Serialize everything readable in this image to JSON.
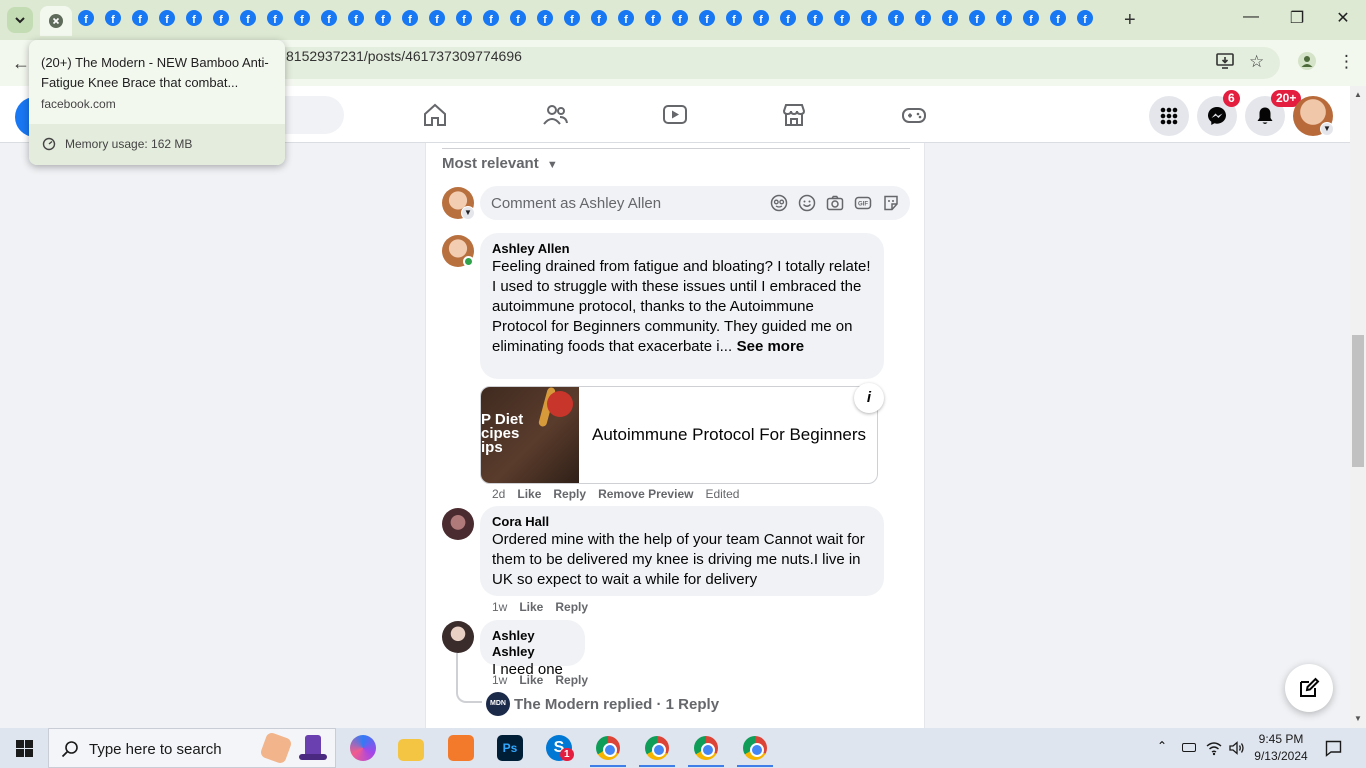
{
  "browser": {
    "url_visible": "8152937231/posts/461737309774696",
    "favicon_letter": "f",
    "favicon_count": 38,
    "tooltip": {
      "title": "(20+) The Modern - NEW Bamboo Anti-Fatigue Knee Brace that combat...",
      "domain": "facebook.com",
      "memory": "Memory usage: 162 MB"
    }
  },
  "header": {
    "messenger_badge": "6",
    "notifications_badge": "20+"
  },
  "comments_section": {
    "sort_label": "Most relevant",
    "comment_placeholder": "Comment as Ashley Allen",
    "comments": [
      {
        "author": "Ashley Allen",
        "text": "Feeling drained from fatigue and bloating? I totally relate! I used to struggle with these issues until I embraced the autoimmune protocol, thanks to the Autoimmune Protocol for Beginners community. They guided me on eliminating foods that exacerbate i...",
        "see_more": "See more",
        "preview_title": "Autoimmune Protocol For Beginners",
        "preview_image_text": "P Diet\ncipes\nips",
        "time": "2d",
        "like": "Like",
        "reply": "Reply",
        "remove_preview": "Remove Preview",
        "edited": "Edited"
      },
      {
        "author": "Cora Hall",
        "text": "Ordered mine with the help of your team Cannot wait for them to be delivered my knee is driving me nuts.I live in UK so expect to wait a while for delivery",
        "time": "1w",
        "like": "Like",
        "reply": "Reply"
      },
      {
        "author": "Ashley Ashley",
        "text": "I need one",
        "time": "1w",
        "like": "Like",
        "reply": "Reply"
      }
    ],
    "replied": {
      "avatar_text": "MDN",
      "text": "The Modern replied · 1 Reply"
    }
  },
  "taskbar": {
    "search_placeholder": "Type here to search",
    "time": "9:45 PM",
    "date": "9/13/2024",
    "skype_badge": "1"
  },
  "colors": {
    "facebook_blue": "#1877f2",
    "badge_red": "#e41e3f",
    "online_green": "#31a24c"
  }
}
